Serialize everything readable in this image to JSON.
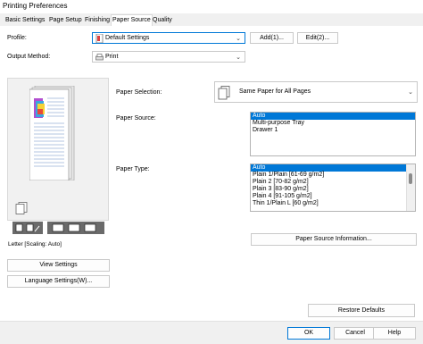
{
  "window": {
    "title": "Printing Preferences"
  },
  "tabs": [
    {
      "label": "Basic Settings"
    },
    {
      "label": "Page Setup"
    },
    {
      "label": "Finishing"
    },
    {
      "label": "Paper Source"
    },
    {
      "label": "Quality"
    }
  ],
  "profile": {
    "label": "Profile:",
    "value": "Default Settings",
    "add_label": "Add(1)...",
    "edit_label": "Edit(2)..."
  },
  "output": {
    "label": "Output Method:",
    "value": "Print"
  },
  "preview": {
    "caption": "Letter [Scaling: Auto]"
  },
  "paper_selection": {
    "label": "Paper Selection:",
    "value": "Same Paper for All Pages"
  },
  "paper_source": {
    "label": "Paper Source:",
    "items": [
      "Auto",
      "Multi-purpose Tray",
      "Drawer 1"
    ],
    "selected": 0
  },
  "paper_type": {
    "label": "Paper Type:",
    "items": [
      "Auto",
      "Plain 1/Plain [61-69 g/m2]",
      "Plain 2 [70-82 g/m2]",
      "Plain 3 [83-90 g/m2]",
      "Plain 4 [91-105 g/m2]",
      "Thin 1/Plain L [60 g/m2]"
    ],
    "selected": 0
  },
  "buttons": {
    "paper_source_info": "Paper Source Information...",
    "view_settings": "View Settings",
    "language_settings": "Language Settings(W)...",
    "restore_defaults": "Restore Defaults",
    "ok": "OK",
    "cancel": "Cancel",
    "help": "Help"
  },
  "colors": {
    "accent": "#0078d7",
    "panel_bg": "#ffffff",
    "window_bg": "#f0f0f0"
  }
}
